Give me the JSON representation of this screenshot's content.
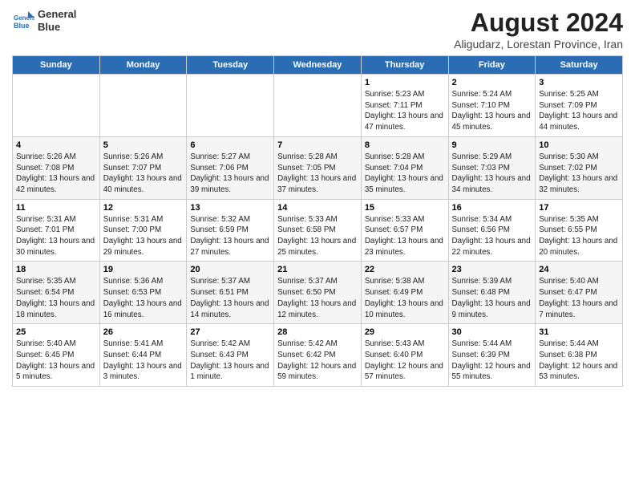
{
  "header": {
    "logo_line1": "General",
    "logo_line2": "Blue",
    "main_title": "August 2024",
    "subtitle": "Aligudarz, Lorestan Province, Iran"
  },
  "columns": [
    "Sunday",
    "Monday",
    "Tuesday",
    "Wednesday",
    "Thursday",
    "Friday",
    "Saturday"
  ],
  "weeks": [
    [
      {
        "day": "",
        "info": ""
      },
      {
        "day": "",
        "info": ""
      },
      {
        "day": "",
        "info": ""
      },
      {
        "day": "",
        "info": ""
      },
      {
        "day": "1",
        "info": "Sunrise: 5:23 AM\nSunset: 7:11 PM\nDaylight: 13 hours and 47 minutes."
      },
      {
        "day": "2",
        "info": "Sunrise: 5:24 AM\nSunset: 7:10 PM\nDaylight: 13 hours and 45 minutes."
      },
      {
        "day": "3",
        "info": "Sunrise: 5:25 AM\nSunset: 7:09 PM\nDaylight: 13 hours and 44 minutes."
      }
    ],
    [
      {
        "day": "4",
        "info": "Sunrise: 5:26 AM\nSunset: 7:08 PM\nDaylight: 13 hours and 42 minutes."
      },
      {
        "day": "5",
        "info": "Sunrise: 5:26 AM\nSunset: 7:07 PM\nDaylight: 13 hours and 40 minutes."
      },
      {
        "day": "6",
        "info": "Sunrise: 5:27 AM\nSunset: 7:06 PM\nDaylight: 13 hours and 39 minutes."
      },
      {
        "day": "7",
        "info": "Sunrise: 5:28 AM\nSunset: 7:05 PM\nDaylight: 13 hours and 37 minutes."
      },
      {
        "day": "8",
        "info": "Sunrise: 5:28 AM\nSunset: 7:04 PM\nDaylight: 13 hours and 35 minutes."
      },
      {
        "day": "9",
        "info": "Sunrise: 5:29 AM\nSunset: 7:03 PM\nDaylight: 13 hours and 34 minutes."
      },
      {
        "day": "10",
        "info": "Sunrise: 5:30 AM\nSunset: 7:02 PM\nDaylight: 13 hours and 32 minutes."
      }
    ],
    [
      {
        "day": "11",
        "info": "Sunrise: 5:31 AM\nSunset: 7:01 PM\nDaylight: 13 hours and 30 minutes."
      },
      {
        "day": "12",
        "info": "Sunrise: 5:31 AM\nSunset: 7:00 PM\nDaylight: 13 hours and 29 minutes."
      },
      {
        "day": "13",
        "info": "Sunrise: 5:32 AM\nSunset: 6:59 PM\nDaylight: 13 hours and 27 minutes."
      },
      {
        "day": "14",
        "info": "Sunrise: 5:33 AM\nSunset: 6:58 PM\nDaylight: 13 hours and 25 minutes."
      },
      {
        "day": "15",
        "info": "Sunrise: 5:33 AM\nSunset: 6:57 PM\nDaylight: 13 hours and 23 minutes."
      },
      {
        "day": "16",
        "info": "Sunrise: 5:34 AM\nSunset: 6:56 PM\nDaylight: 13 hours and 22 minutes."
      },
      {
        "day": "17",
        "info": "Sunrise: 5:35 AM\nSunset: 6:55 PM\nDaylight: 13 hours and 20 minutes."
      }
    ],
    [
      {
        "day": "18",
        "info": "Sunrise: 5:35 AM\nSunset: 6:54 PM\nDaylight: 13 hours and 18 minutes."
      },
      {
        "day": "19",
        "info": "Sunrise: 5:36 AM\nSunset: 6:53 PM\nDaylight: 13 hours and 16 minutes."
      },
      {
        "day": "20",
        "info": "Sunrise: 5:37 AM\nSunset: 6:51 PM\nDaylight: 13 hours and 14 minutes."
      },
      {
        "day": "21",
        "info": "Sunrise: 5:37 AM\nSunset: 6:50 PM\nDaylight: 13 hours and 12 minutes."
      },
      {
        "day": "22",
        "info": "Sunrise: 5:38 AM\nSunset: 6:49 PM\nDaylight: 13 hours and 10 minutes."
      },
      {
        "day": "23",
        "info": "Sunrise: 5:39 AM\nSunset: 6:48 PM\nDaylight: 13 hours and 9 minutes."
      },
      {
        "day": "24",
        "info": "Sunrise: 5:40 AM\nSunset: 6:47 PM\nDaylight: 13 hours and 7 minutes."
      }
    ],
    [
      {
        "day": "25",
        "info": "Sunrise: 5:40 AM\nSunset: 6:45 PM\nDaylight: 13 hours and 5 minutes."
      },
      {
        "day": "26",
        "info": "Sunrise: 5:41 AM\nSunset: 6:44 PM\nDaylight: 13 hours and 3 minutes."
      },
      {
        "day": "27",
        "info": "Sunrise: 5:42 AM\nSunset: 6:43 PM\nDaylight: 13 hours and 1 minute."
      },
      {
        "day": "28",
        "info": "Sunrise: 5:42 AM\nSunset: 6:42 PM\nDaylight: 12 hours and 59 minutes."
      },
      {
        "day": "29",
        "info": "Sunrise: 5:43 AM\nSunset: 6:40 PM\nDaylight: 12 hours and 57 minutes."
      },
      {
        "day": "30",
        "info": "Sunrise: 5:44 AM\nSunset: 6:39 PM\nDaylight: 12 hours and 55 minutes."
      },
      {
        "day": "31",
        "info": "Sunrise: 5:44 AM\nSunset: 6:38 PM\nDaylight: 12 hours and 53 minutes."
      }
    ]
  ]
}
